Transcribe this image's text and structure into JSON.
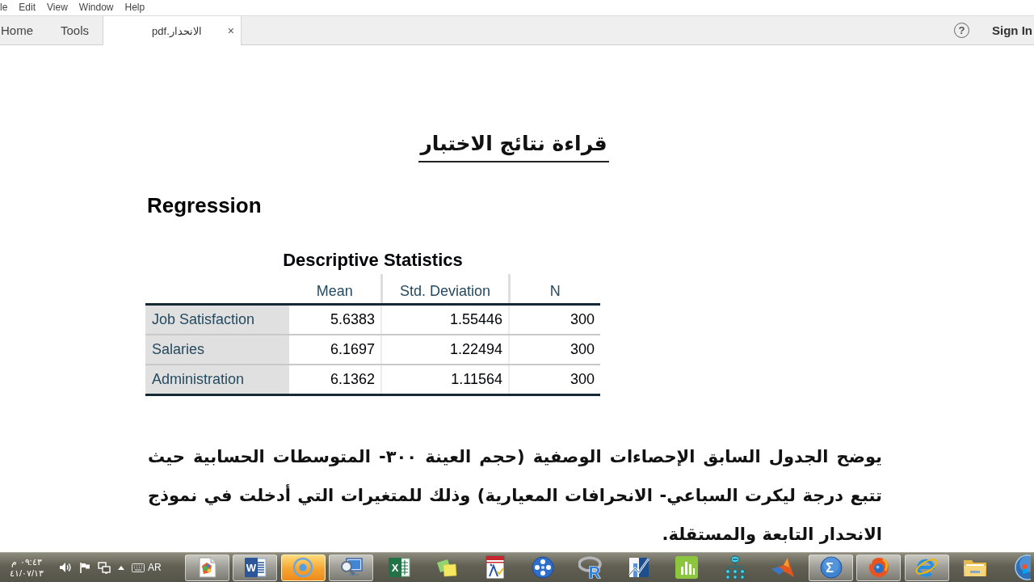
{
  "menu_bar": {
    "items": [
      "le",
      "Edit",
      "View",
      "Window",
      "Help"
    ]
  },
  "tab_bar": {
    "tabs": [
      {
        "label": "Home",
        "selected": false
      },
      {
        "label": "Tools",
        "selected": false
      },
      {
        "label": "الانحدار.pdf",
        "selected": true,
        "close": "×"
      }
    ],
    "help": "?",
    "sign_in": "Sign In"
  },
  "document": {
    "heading": "قراءة نتائج الاختبار",
    "section_title": "Regression",
    "table": {
      "title": "Descriptive Statistics",
      "columns": [
        "Mean",
        "Std. Deviation",
        "N"
      ],
      "rows": [
        {
          "label": "Job Satisfaction",
          "cells": [
            "5.6383",
            "1.55446",
            "300"
          ]
        },
        {
          "label": "Salaries",
          "cells": [
            "6.1697",
            "1.22494",
            "300"
          ]
        },
        {
          "label": "Administration",
          "cells": [
            "6.1362",
            "1.11564",
            "300"
          ]
        }
      ]
    },
    "paragraph": "يوضح الجدول السابق الإحصاءات الوصفية (حجم العينة ٣٠٠- المتوسطات الحسابية حيث تتبع درجة ليكرت السباعي- الانحرافات المعيارية) وذلك للمتغيرات التي أدخلت في نموذج الانحدار التابعة والمستقلة."
  },
  "taskbar": {
    "tray": {
      "time": "٠٩:٤٣ م",
      "date": "٤١/٠٧/١٣",
      "language": "AR"
    },
    "apps": [
      {
        "kind": "paint-file",
        "running": true,
        "selected": false
      },
      {
        "kind": "w-doc",
        "letter": "W",
        "running": true,
        "selected": false
      },
      {
        "kind": "disc",
        "running": true,
        "selected": true
      },
      {
        "kind": "monitor-search",
        "running": true,
        "selected": false
      },
      {
        "kind": "x-sheet",
        "letter": "X",
        "running": false,
        "selected": false
      },
      {
        "kind": "notes",
        "running": false,
        "selected": false
      },
      {
        "kind": "banner-doc",
        "running": false,
        "selected": false
      },
      {
        "kind": "ball",
        "running": false,
        "selected": false
      },
      {
        "kind": "r-logo",
        "letter": "R",
        "running": false,
        "selected": false
      },
      {
        "kind": "line-chart",
        "running": false,
        "selected": false
      },
      {
        "kind": "bar-chart",
        "running": false,
        "selected": false
      },
      {
        "kind": "tree",
        "running": false,
        "selected": false
      },
      {
        "kind": "peak",
        "running": false,
        "selected": false
      },
      {
        "kind": "sigma",
        "letter": "Σ",
        "running": true,
        "selected": false
      },
      {
        "kind": "swirl",
        "running": true,
        "selected": false
      },
      {
        "kind": "e-logo",
        "running": true,
        "selected": false
      },
      {
        "kind": "folder",
        "running": false,
        "selected": false
      },
      {
        "kind": "orb",
        "running": false,
        "selected": false
      }
    ]
  }
}
